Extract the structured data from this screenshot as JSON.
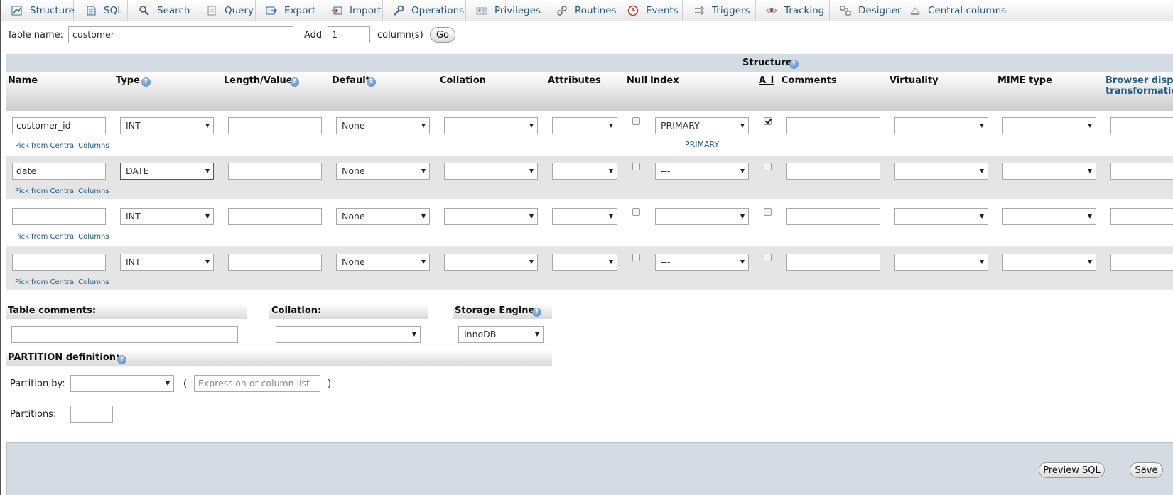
{
  "tabs": [
    {
      "label": "Structure",
      "icon": "structure-icon"
    },
    {
      "label": "SQL",
      "icon": "sql-icon"
    },
    {
      "label": "Search",
      "icon": "search-icon"
    },
    {
      "label": "Query",
      "icon": "query-icon"
    },
    {
      "label": "Export",
      "icon": "export-icon"
    },
    {
      "label": "Import",
      "icon": "import-icon"
    },
    {
      "label": "Operations",
      "icon": "wrench-icon"
    },
    {
      "label": "Privileges",
      "icon": "privileges-icon"
    },
    {
      "label": "Routines",
      "icon": "routines-icon"
    },
    {
      "label": "Events",
      "icon": "clock-icon"
    },
    {
      "label": "Triggers",
      "icon": "triggers-icon"
    },
    {
      "label": "Tracking",
      "icon": "eye-icon"
    },
    {
      "label": "Designer",
      "icon": "designer-icon"
    },
    {
      "label": "Central columns",
      "icon": "central-columns-icon"
    }
  ],
  "tablename": {
    "label": "Table name:",
    "value": "customer",
    "add_label": "Add",
    "add_value": "1",
    "columns_label": "column(s)",
    "go_label": "Go"
  },
  "structure_title": "Structure",
  "headers": {
    "name": "Name",
    "type": "Type",
    "length": "Length/Values",
    "default": "Default",
    "collation": "Collation",
    "attributes": "Attributes",
    "null": "Null",
    "index": "Index",
    "ai": "A_I",
    "comments": "Comments",
    "virtuality": "Virtuality",
    "mime": "MIME type",
    "browser1": "Browser display",
    "browser2": "transformation"
  },
  "rows": [
    {
      "name": "customer_id",
      "type": "INT",
      "default": "None",
      "null": false,
      "index": "PRIMARY",
      "index_note": "PRIMARY",
      "ai": true,
      "pick": "Pick from Central Columns"
    },
    {
      "name": "date",
      "type": "DATE",
      "default": "None",
      "null": false,
      "index": "---",
      "index_note": "",
      "ai": false,
      "pick": "Pick from Central Columns"
    },
    {
      "name": "",
      "type": "INT",
      "default": "None",
      "null": false,
      "index": "---",
      "index_note": "",
      "ai": false,
      "pick": "Pick from Central Columns"
    },
    {
      "name": "",
      "type": "INT",
      "default": "None",
      "null": false,
      "index": "---",
      "index_note": "",
      "ai": false,
      "pick": "Pick from Central Columns"
    }
  ],
  "bottom": {
    "table_comments": "Table comments:",
    "collation": "Collation:",
    "storage_engine": "Storage Engine:",
    "engine_value": "InnoDB",
    "partition_definition": "PARTITION definition:",
    "partition_by": "Partition by:",
    "partition_placeholder": "Expression or column list",
    "open_paren": "(",
    "close_paren": ")",
    "partitions": "Partitions:"
  },
  "actions": {
    "preview_sql": "Preview SQL",
    "save": "Save"
  },
  "colors": {
    "row_alt": "#e5e5e5",
    "row": "#ffffff",
    "header_bg": "#d3dce3",
    "link": "#235a81",
    "footer_bg": "#d3dce3"
  }
}
